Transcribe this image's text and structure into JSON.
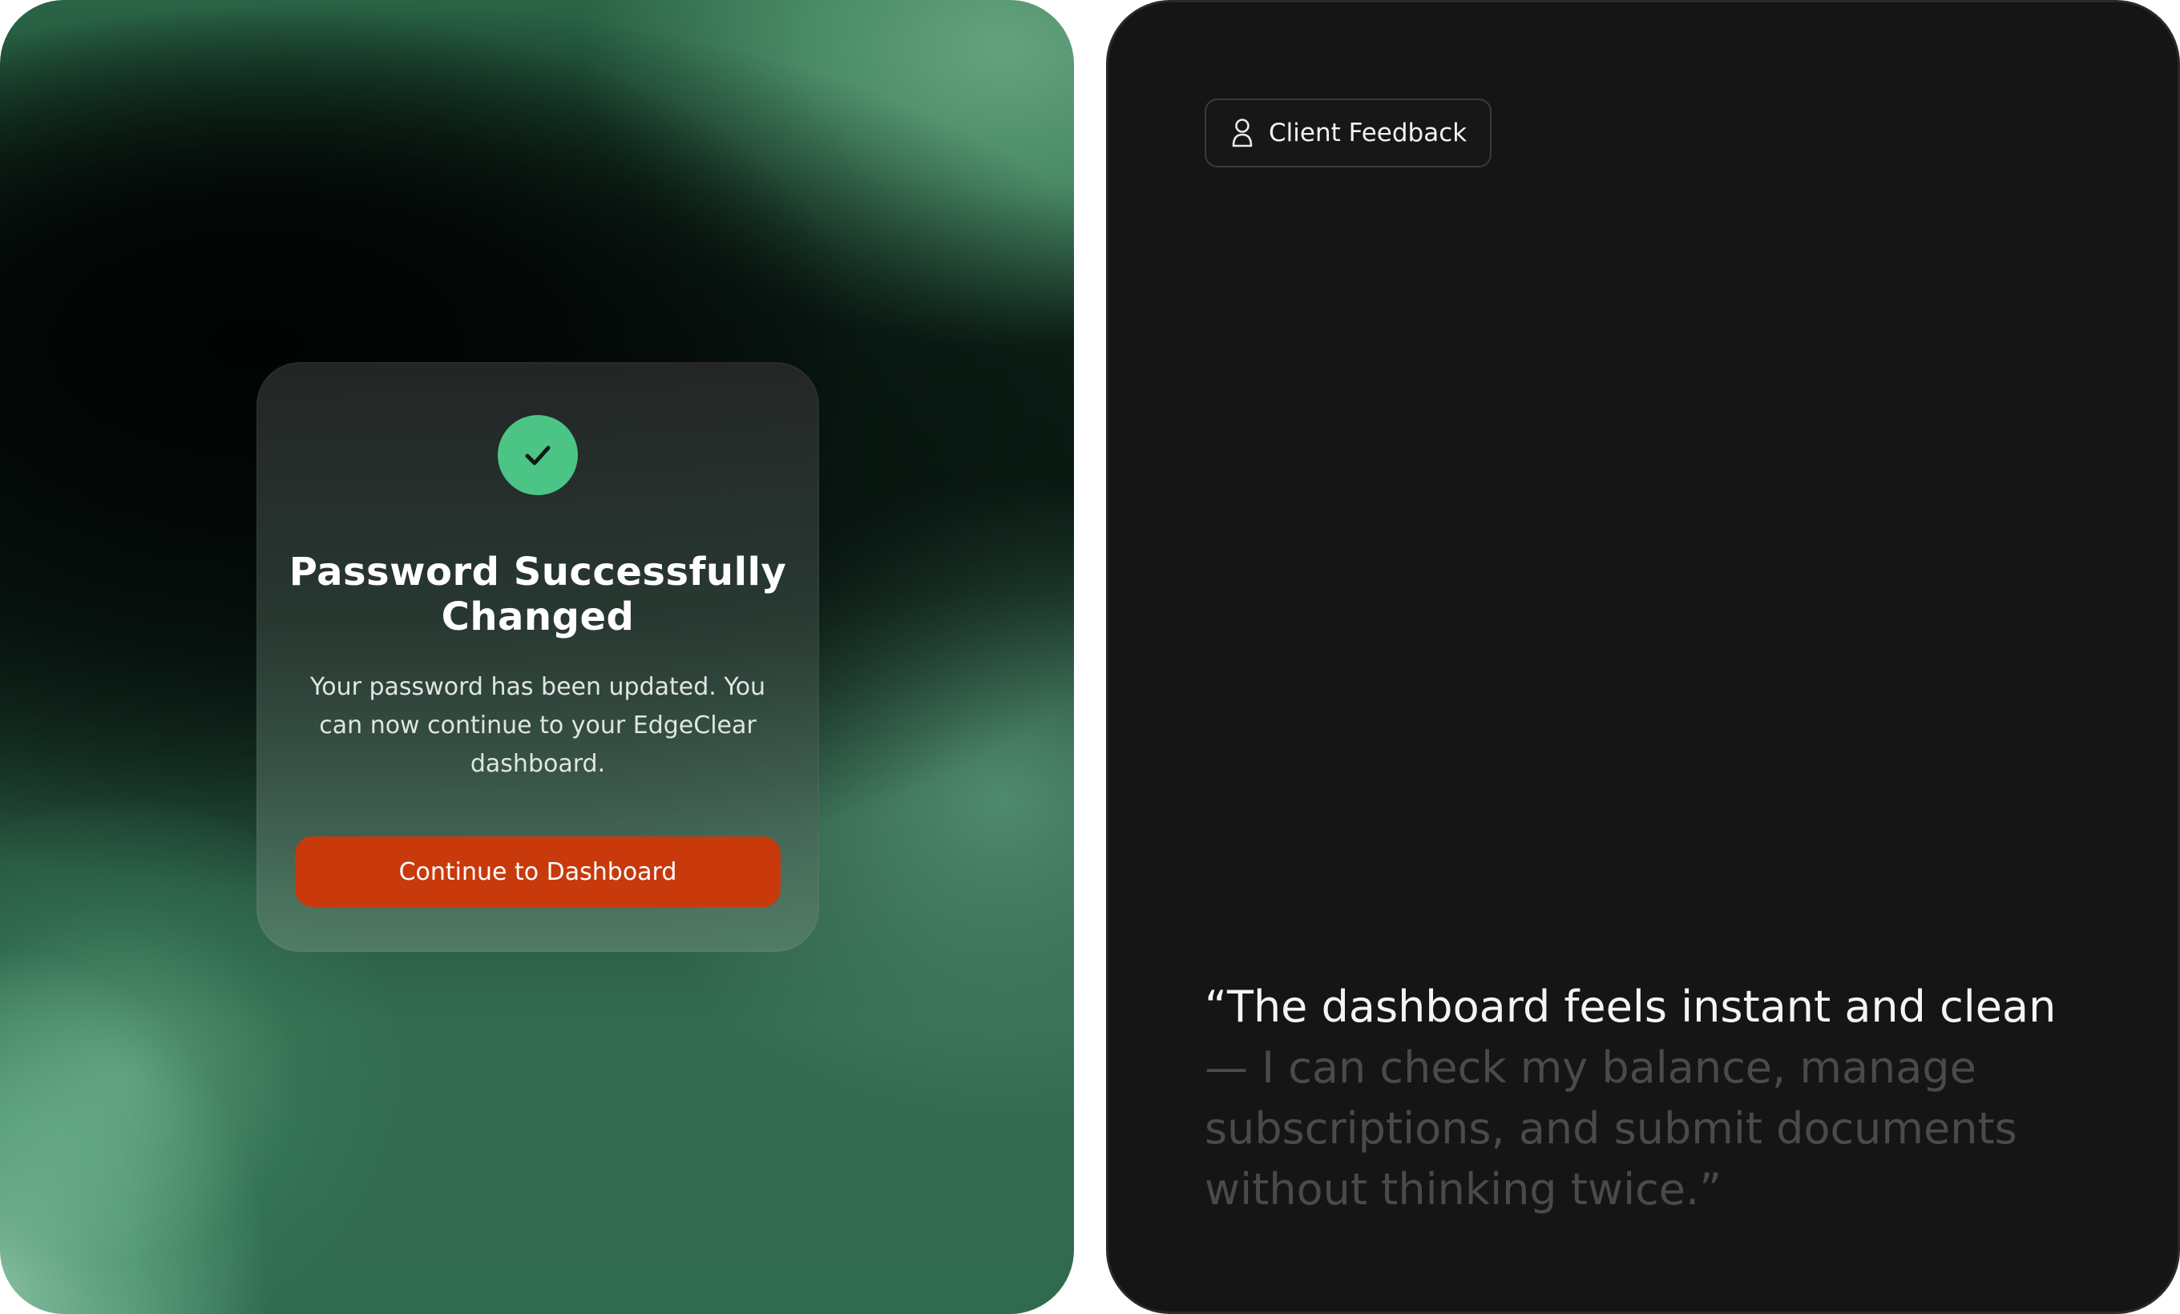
{
  "success_card": {
    "title": "Password Successfully Changed",
    "body": "Your password has been updated. You can now continue to your EdgeClear dashboard.",
    "button_label": "Continue to Dashboard",
    "icon": "check-icon",
    "accent_color": "#4cc485",
    "button_color": "#c8390c"
  },
  "testimonial": {
    "chip_label": "Client Feedback",
    "chip_icon": "user-icon",
    "quote_highlight": "“The dashboard feels instant and clean",
    "quote_dash": " —",
    "quote_rest": " I can check my balance, manage subscriptions, and submit documents without thinking twice.”"
  }
}
